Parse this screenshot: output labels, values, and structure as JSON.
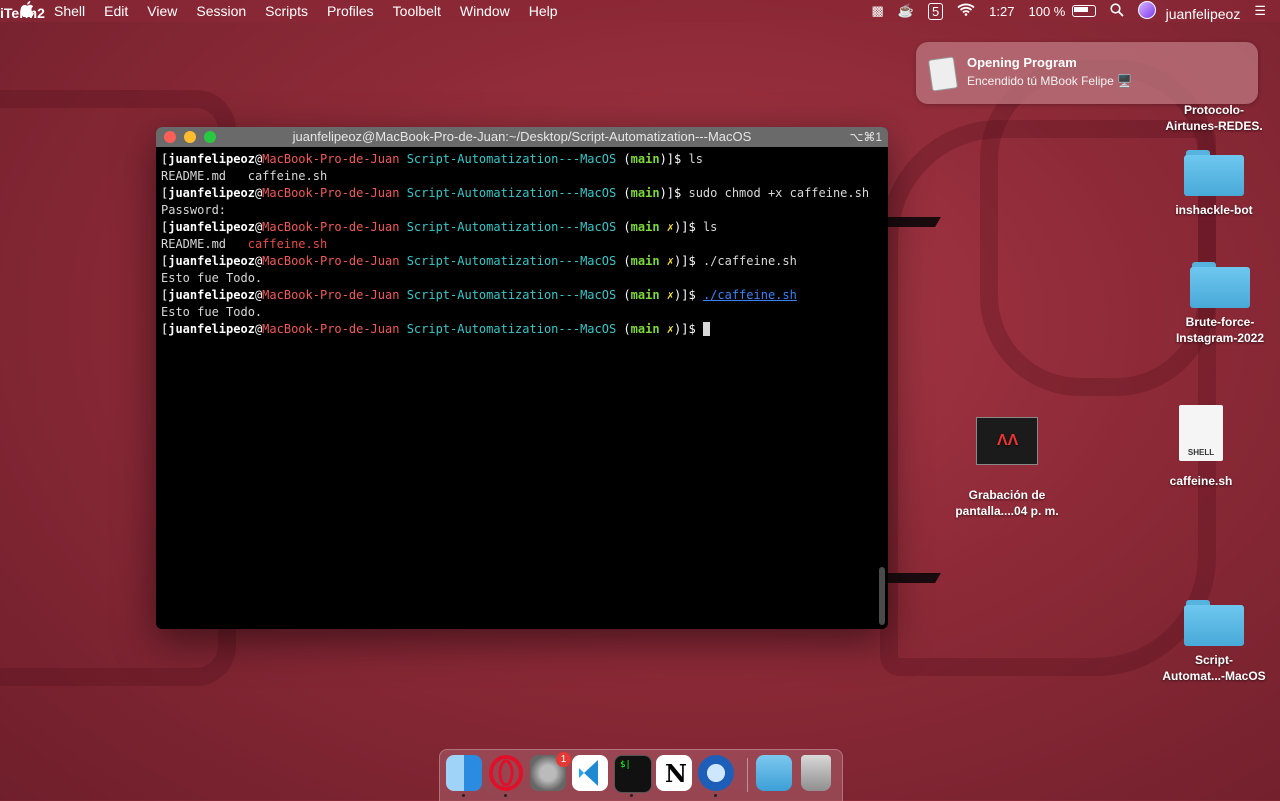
{
  "menubar": {
    "app_name": "iTerm2",
    "menus": [
      "Shell",
      "Edit",
      "View",
      "Session",
      "Scripts",
      "Profiles",
      "Toolbelt",
      "Window",
      "Help"
    ],
    "notification_count": "5",
    "time": "1:27",
    "battery": "100 %",
    "username": "juanfelipeoz"
  },
  "notification": {
    "title": "Opening Program",
    "body": "Encendido tú MBook Felipe 🖥️"
  },
  "terminal": {
    "title": "juanfelipeoz@MacBook-Pro-de-Juan:~/Desktop/Script-Automatization---MacOS",
    "shortcut": "⌥⌘1",
    "prompt_user": "juanfelipeoz",
    "prompt_host": "MacBook-Pro-de-Juan",
    "prompt_dir": "Script-Automatization---MacOS",
    "prompt_branch": "main",
    "dirty_mark": "✗",
    "lines": [
      {
        "type": "prompt",
        "dirty": false,
        "cmd": "ls"
      },
      {
        "type": "ls",
        "a": "README.md",
        "b": "caffeine.sh",
        "exec": false
      },
      {
        "type": "prompt",
        "dirty": false,
        "cmd": "sudo chmod +x caffeine.sh"
      },
      {
        "type": "out",
        "text": "Password:"
      },
      {
        "type": "prompt",
        "dirty": true,
        "cmd": "ls"
      },
      {
        "type": "ls",
        "a": "README.md",
        "b": "caffeine.sh",
        "exec": true
      },
      {
        "type": "prompt",
        "dirty": true,
        "cmd": "./caffeine.sh"
      },
      {
        "type": "out",
        "text": "Esto fue Todo."
      },
      {
        "type": "prompt",
        "dirty": true,
        "cmd": "./caffeine.sh",
        "link": true
      },
      {
        "type": "out",
        "text": "Esto fue Todo."
      },
      {
        "type": "prompt",
        "dirty": true,
        "cmd": "",
        "cursor": true
      }
    ]
  },
  "desktop_icons": [
    {
      "label": "Protocolo-\nAirtunes-REDES.",
      "kind": "folder"
    },
    {
      "label": "inshackle-bot",
      "kind": "folder"
    },
    {
      "label": "Brute-force-\nInstagram-2022",
      "kind": "folder"
    },
    {
      "label": "Grabación de\npantalla....04 p. m.",
      "kind": "video"
    },
    {
      "label": "caffeine.sh",
      "kind": "shell",
      "doc_label": "SHELL"
    },
    {
      "label": "Script-\nAutomat...-MacOS",
      "kind": "folder"
    }
  ],
  "dock": {
    "apps": [
      "finder-icon",
      "opera-icon",
      "system-preferences-icon",
      "vscode-icon",
      "iterm-icon",
      "notion-icon",
      "quicktime-icon"
    ],
    "prefs_badge": "1"
  }
}
